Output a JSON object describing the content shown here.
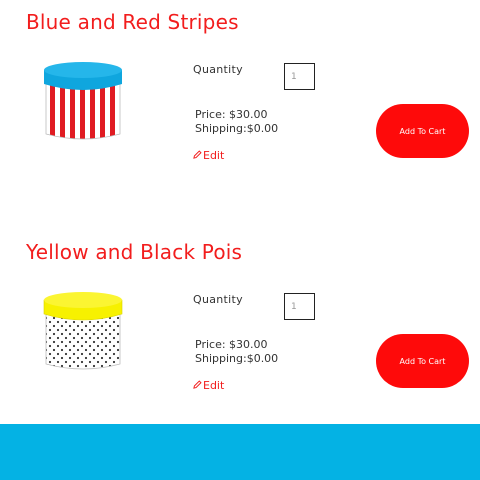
{
  "products": [
    {
      "title": "Blue and Red Stripes",
      "image_icon": "blue-red-striped-box-icon",
      "quantity_label": "Quantity",
      "quantity_value": "1",
      "price": "Price: $30.00",
      "shipping": "Shipping:$0.00",
      "edit_label": "Edit",
      "edit_icon": "pencil-icon",
      "add_to_cart_label": "Add To Cart",
      "colors": {
        "lid": "#0fa6de",
        "stripes": "#e01b22",
        "title": "#f21d1d"
      }
    },
    {
      "title": "Yellow and Black Pois",
      "image_icon": "yellow-polka-dot-box-icon",
      "quantity_label": "Quantity",
      "quantity_value": "1",
      "price": "Price: $30.00",
      "shipping": "Shipping:$0.00",
      "edit_label": "Edit",
      "edit_icon": "pencil-icon",
      "add_to_cart_label": "Add To Cart",
      "colors": {
        "lid": "#f7f100",
        "dots": "#333333",
        "title": "#f21d1d"
      }
    }
  ],
  "theme": {
    "accent_red": "#fe0a0a",
    "footer_blue": "#04b2e4"
  }
}
